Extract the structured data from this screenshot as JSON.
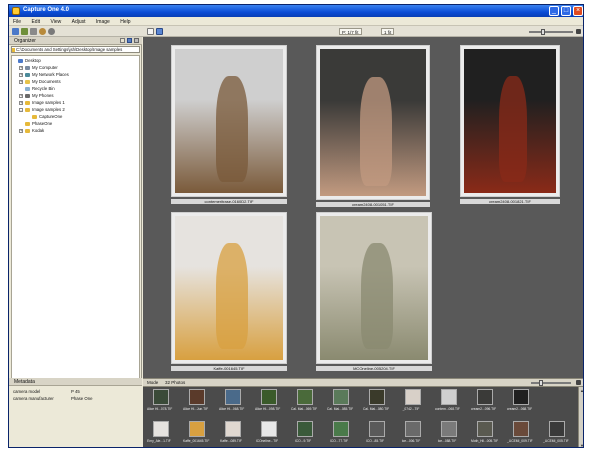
{
  "window": {
    "title": "Capture One 4.0",
    "controls": {
      "minimize": "_",
      "maximize": "□",
      "close": "×"
    }
  },
  "menu": [
    "File",
    "Edit",
    "View",
    "Adjust",
    "Image",
    "Help"
  ],
  "toolbar": {
    "zoom_value": "P: 1/7 fit",
    "page_value": "1 fit"
  },
  "organizer": {
    "title": "Organizer",
    "path": "C:\\Documents and Settings\\jsh\\Desktop\\Image samples",
    "tree": [
      {
        "label": "Desktop",
        "icon": "desktop-icon",
        "level": 0,
        "expander": ""
      },
      {
        "label": "My Computer",
        "icon": "computer-icon",
        "level": 1,
        "expander": "+"
      },
      {
        "label": "My Network Places",
        "icon": "network-icon",
        "level": 1,
        "expander": "+"
      },
      {
        "label": "My Documents",
        "icon": "documents-icon",
        "level": 1,
        "expander": "+"
      },
      {
        "label": "Recycle Bin",
        "icon": "recycle-bin-icon",
        "level": 1,
        "expander": ""
      },
      {
        "label": "My Phones",
        "icon": "phone-icon",
        "level": 1,
        "expander": "+"
      },
      {
        "label": "Image samples 1",
        "icon": "folder-icon",
        "level": 1,
        "expander": "+"
      },
      {
        "label": "Image samples 2",
        "icon": "folder-icon",
        "level": 1,
        "expander": "-"
      },
      {
        "label": "CaptureOne",
        "icon": "folder-icon",
        "level": 2,
        "expander": ""
      },
      {
        "label": "PhaseOne",
        "icon": "folder-icon",
        "level": 1,
        "expander": ""
      },
      {
        "label": "Kodak",
        "icon": "folder-icon",
        "level": 1,
        "expander": "+"
      }
    ]
  },
  "metadata": {
    "title": "Metadata",
    "rows": [
      {
        "key": "camera model",
        "value": "P 45"
      },
      {
        "key": "camera manufacturer",
        "value": "Phase One"
      }
    ]
  },
  "thumbnails": [
    {
      "caption": "contemeritrase-0160D2.TIF",
      "tone": "#cfcfcf",
      "accent": "#7a5a3a"
    },
    {
      "caption": "cream2408-001051.TIF",
      "tone": "#3a3a38",
      "accent": "#c29a80"
    },
    {
      "caption": "cream2408-001821.TIF",
      "tone": "#202020",
      "accent": "#8a2a18"
    },
    {
      "caption": "Kaffe-001645.TIF",
      "tone": "#e6e3df",
      "accent": "#d8a040"
    },
    {
      "caption": "MCOneline-005204.TIF",
      "tone": "#c8c4b4",
      "accent": "#8a8a70"
    }
  ],
  "filmstrip": {
    "mode_label": "Mode",
    "count_label": "32 Photos",
    "row1": [
      {
        "caption": "Alice Hl...078.TIF",
        "tone": "#3a4a38"
      },
      {
        "caption": "Alice Hl...Jun.TIF",
        "tone": "#5a3a2a"
      },
      {
        "caption": "Alice Hl...068.TIF",
        "tone": "#4a6a8a"
      },
      {
        "caption": "Alice Hl...098.TIF",
        "tone": "#3a5a2a"
      },
      {
        "caption": "Cal. Mal...069.TIF",
        "tone": "#4a6a3a"
      },
      {
        "caption": "Cal. Mal...085.TIF",
        "tone": "#5a7a5a"
      },
      {
        "caption": "Cal. Mal...080.TIF",
        "tone": "#3a3a2a"
      },
      {
        "caption": "_0742...TIF",
        "tone": "#d8d0c8"
      },
      {
        "caption": "contem...068.TIF",
        "tone": "#cfcfcf"
      },
      {
        "caption": "cream2...096.TIF",
        "tone": "#3a3a38"
      },
      {
        "caption": "cream2...068.TIF",
        "tone": "#202020"
      }
    ],
    "row2": [
      {
        "caption": "Emy_Ale...1.TIF",
        "tone": "#e6e3df"
      },
      {
        "caption": "Kaffe_001645.TIF",
        "tone": "#d8a040"
      },
      {
        "caption": "Kaffe...089.TIF",
        "tone": "#e0d8d0"
      },
      {
        "caption": "ICOneline...TIF",
        "tone": "#e8e8e8"
      },
      {
        "caption": "ICO...9.TIF",
        "tone": "#3a5a3a"
      },
      {
        "caption": "ICO...77.TIF",
        "tone": "#4a7a4a"
      },
      {
        "caption": "ICO...85.TIF",
        "tone": "#5a5a5a"
      },
      {
        "caption": "Ice...006.TIF",
        "tone": "#6a6a6a"
      },
      {
        "caption": "Ice...088.TIF",
        "tone": "#7a7a7a"
      },
      {
        "caption": "Moth_Hil...005.TIF",
        "tone": "#5a5a50"
      },
      {
        "caption": "_UCEMI_009.TIF",
        "tone": "#6a4a3a"
      },
      {
        "caption": "_UCEMI_005.TIF",
        "tone": "#3a3a3a"
      }
    ]
  },
  "colors": {
    "titlebar": "#0a4cd6",
    "viewer_bg": "#595959",
    "selection": "#ffffff"
  }
}
